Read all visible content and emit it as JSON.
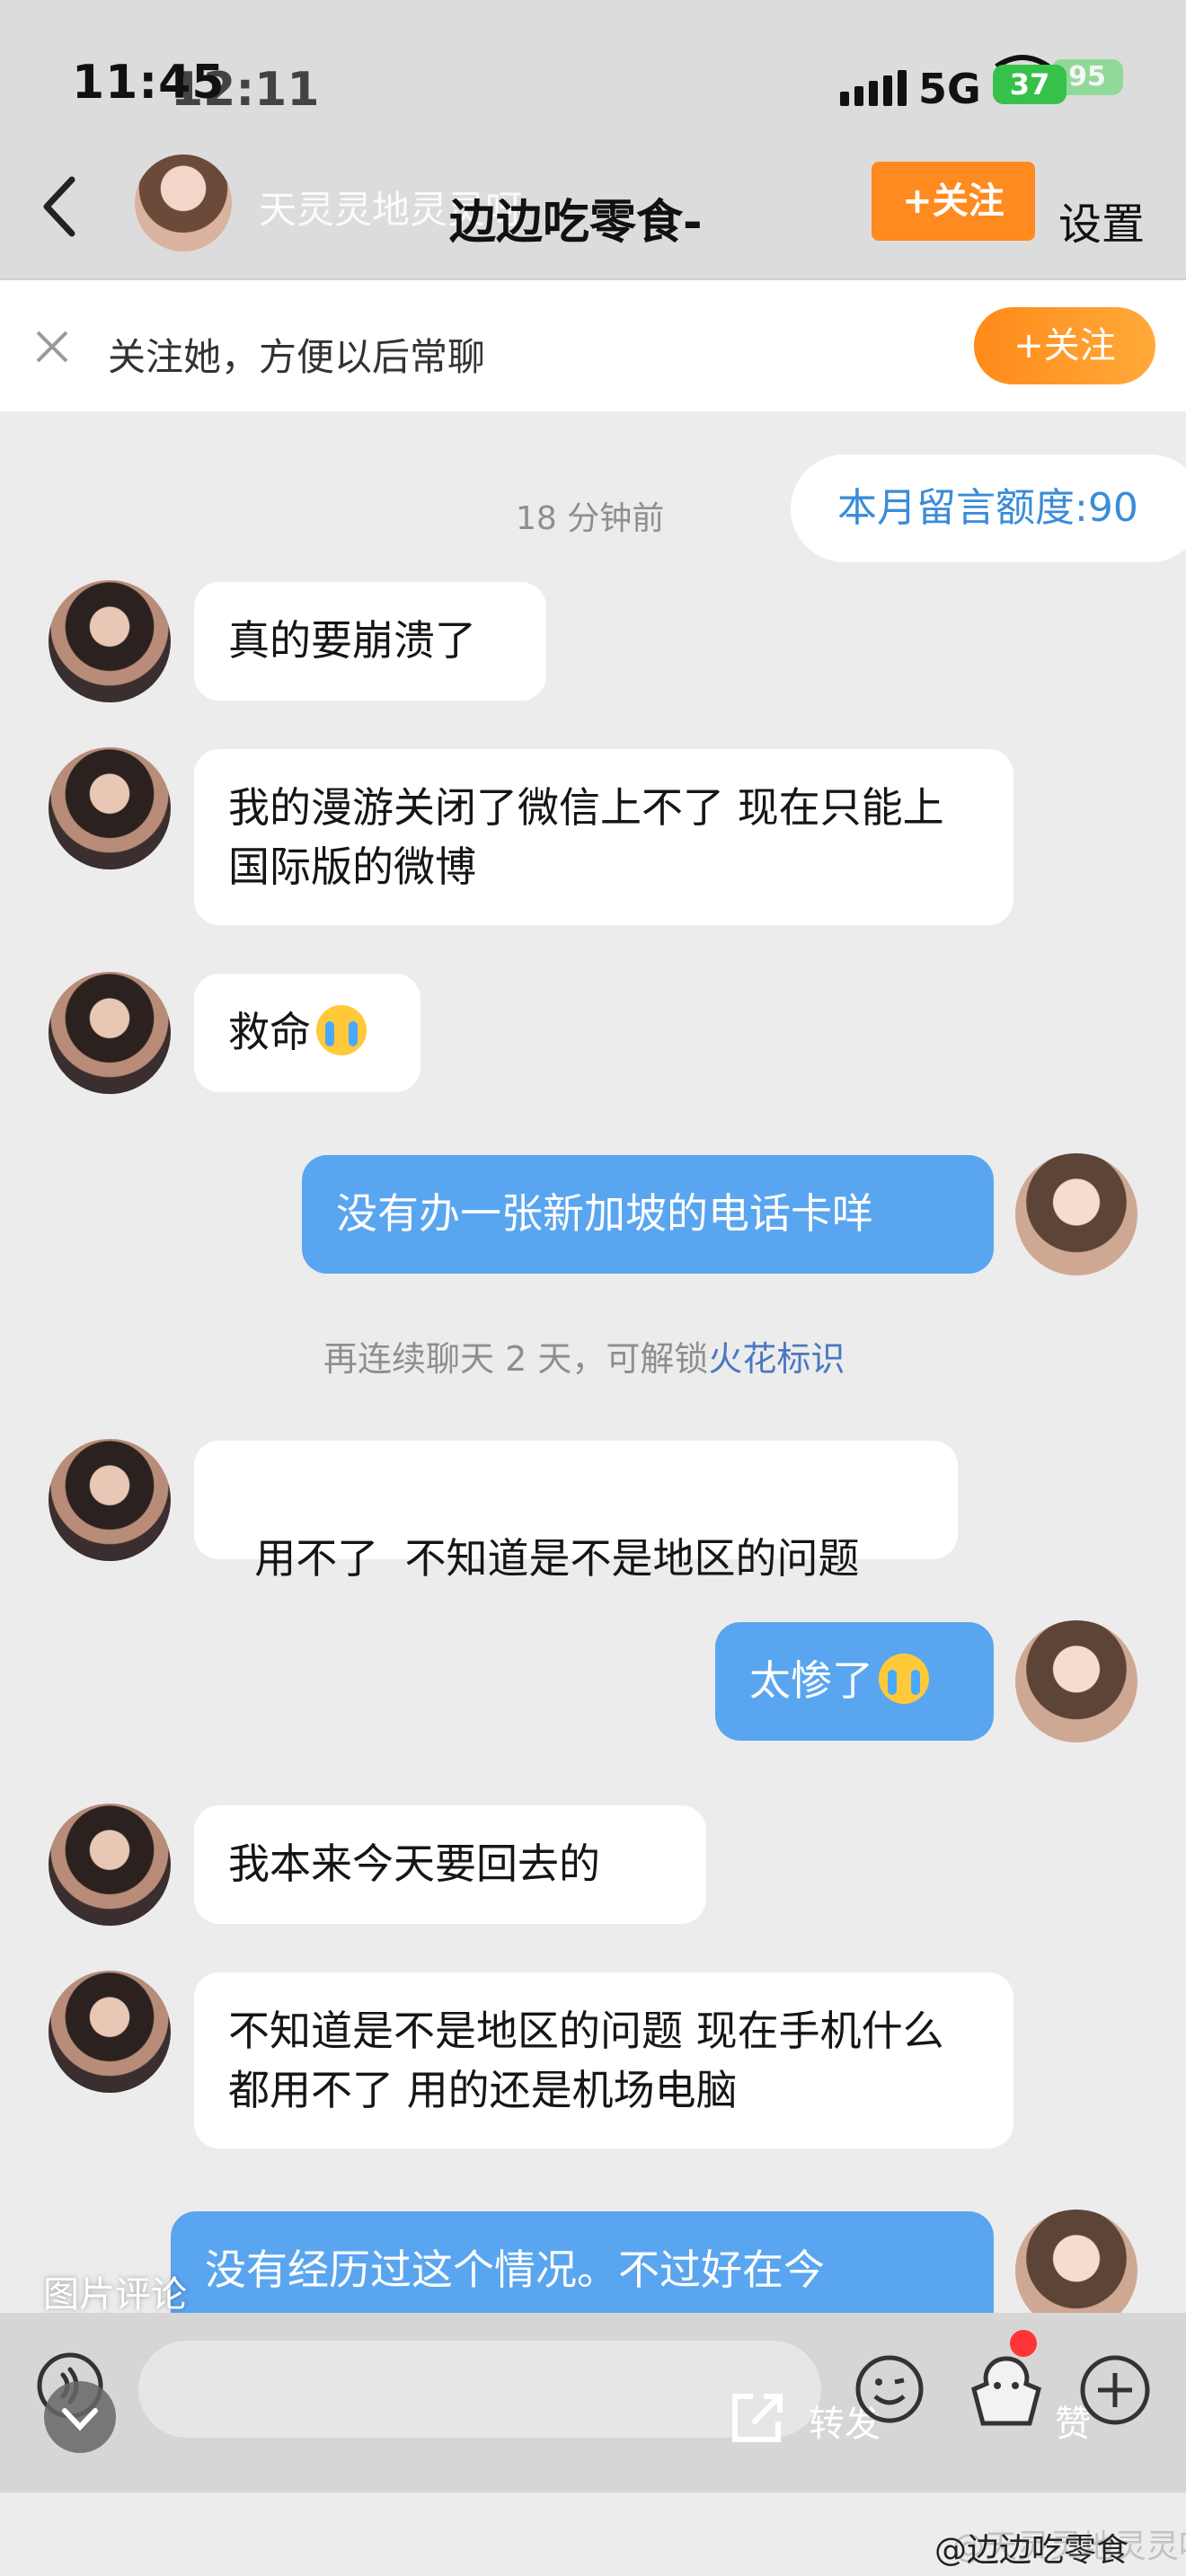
{
  "status_bar": {
    "time": "11:45",
    "time_overlay": "12:11",
    "network": "5G",
    "battery": "37",
    "battery_overlay": "95"
  },
  "nav": {
    "back_icon": "chevron-left-icon",
    "overlay_nickname": "天灵灵地灵灵呀",
    "title": "边边吃零食-",
    "follow_label": "+关注",
    "settings_label": "设置"
  },
  "follow_banner": {
    "text": "关注她，方便以后常聊",
    "button": "+关注"
  },
  "chat": {
    "timestamp": "18 分钟前",
    "quota": "本月留言额度:90",
    "messages": [
      {
        "side": "in",
        "text": "真的要崩溃了"
      },
      {
        "side": "in",
        "text": "我的漫游关闭了微信上不了 现在只能上国际版的微博"
      },
      {
        "side": "in",
        "text": "救命"
      },
      {
        "side": "out",
        "text": "没有办一张新加坡的电话卡咩"
      },
      {
        "side": "in",
        "text": "用不了  不知道是不是地区的问题"
      },
      {
        "side": "out",
        "text": "太惨了"
      },
      {
        "side": "in",
        "text": "我本来今天要回去的"
      },
      {
        "side": "in",
        "text": "不知道是不是地区的问题 现在手机什么都用不了 用的还是机场电脑"
      },
      {
        "side": "out",
        "text": "没有经历过这个情况。不过好在今"
      }
    ],
    "spark_hint": "再连续聊天 2 天，可解锁",
    "spark_link": "火花标识"
  },
  "bottom": {
    "image_comment": "图片评论",
    "share_label": "转发",
    "like_label": "赞",
    "icons": [
      "voice-icon",
      "emoji-icon",
      "like-icon",
      "plus-icon",
      "share-icon"
    ]
  },
  "watermark": "@边边吃零食",
  "watermark_ghost": "@天灵灵地灵灵呀"
}
